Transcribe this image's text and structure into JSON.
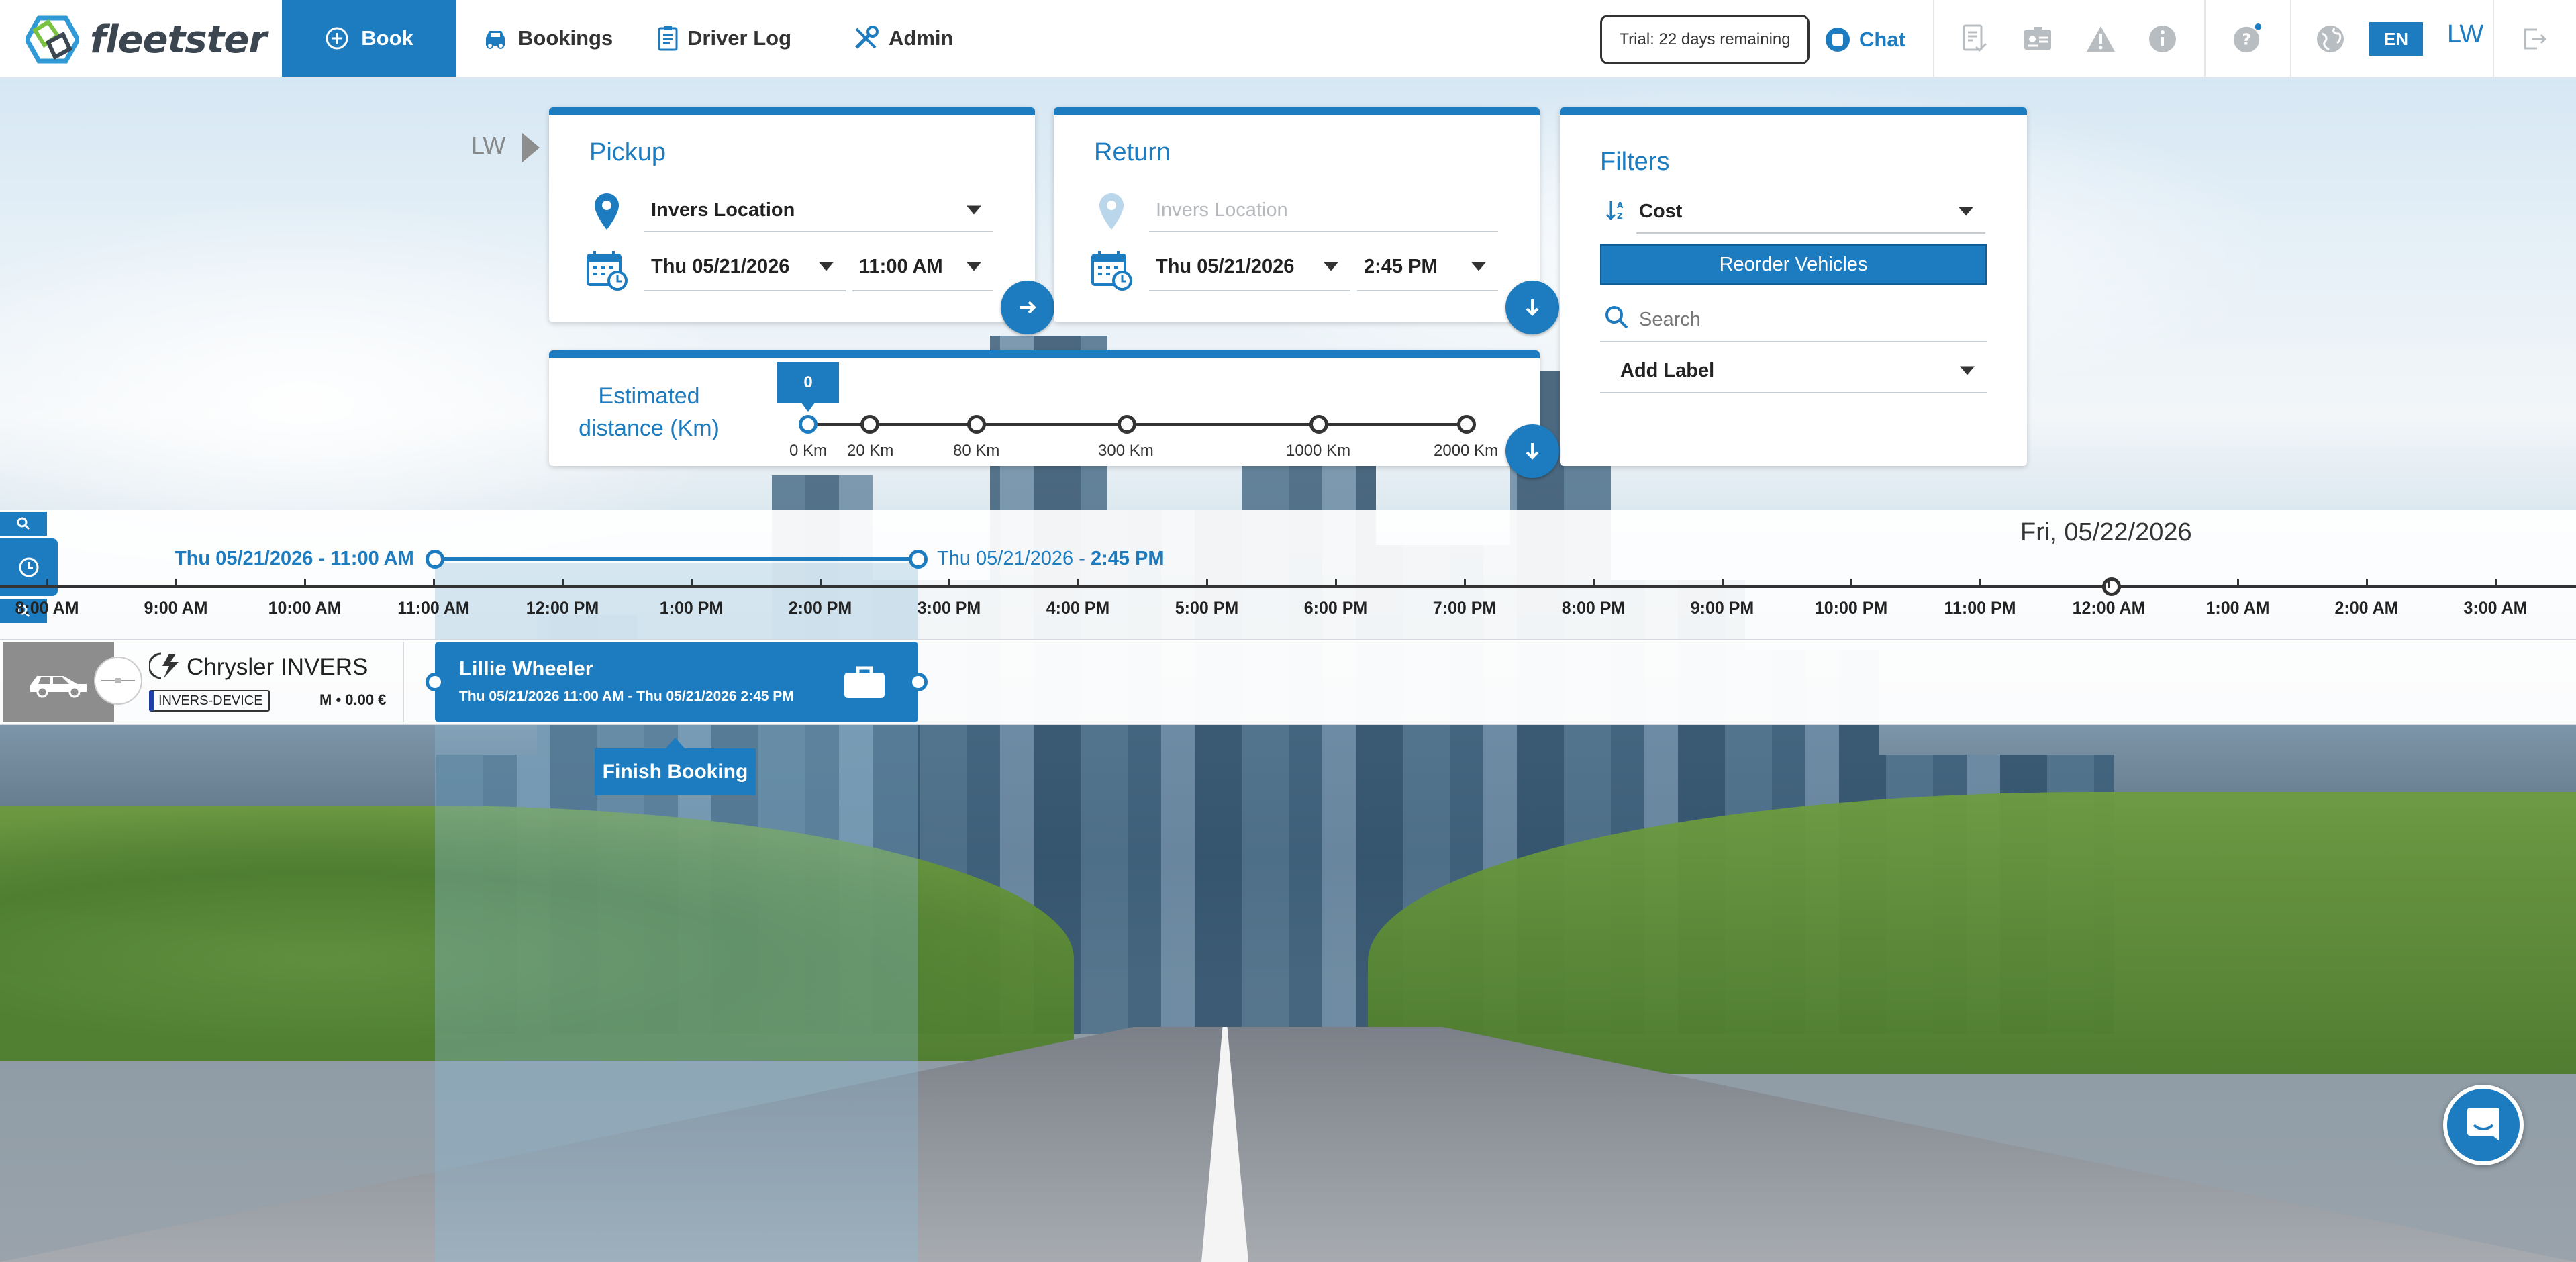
{
  "brand": {
    "name": "fleetster",
    "accent": "#1d7cbf"
  },
  "nav": {
    "book": "Book",
    "bookings": "Bookings",
    "driver_log": "Driver Log",
    "admin": "Admin"
  },
  "header": {
    "trial": "Trial: 22 days remaining",
    "chat": "Chat",
    "language": "EN",
    "user_initials": "LW",
    "icons": [
      "reports-icon",
      "id-card-icon",
      "warning-icon",
      "info-icon",
      "help-icon",
      "globe-icon",
      "logout-icon"
    ]
  },
  "driver_label": "LW",
  "pickup": {
    "title": "Pickup",
    "location": "Invers Location",
    "date": "Thu 05/21/2026",
    "time": "11:00 AM"
  },
  "return": {
    "title": "Return",
    "location_placeholder": "Invers Location",
    "date": "Thu 05/21/2026",
    "time": "2:45 PM"
  },
  "filters": {
    "title": "Filters",
    "sort": "Cost",
    "reorder_button": "Reorder Vehicles",
    "search_placeholder": "Search",
    "label_select": "Add Label"
  },
  "distance": {
    "title_line1": "Estimated",
    "title_line2": "distance (Km)",
    "selected": "0",
    "stops": [
      "0 Km",
      "20 Km",
      "80 Km",
      "300 Km",
      "1000 Km",
      "2000 Km"
    ]
  },
  "timeline": {
    "start_date": "Thu 05/21/2026 - ",
    "start_time": "11:00 AM",
    "end_date": "Thu 05/21/2026 - ",
    "end_time": "2:45 PM",
    "next_day": "Fri, 05/22/2026",
    "hours": [
      "8:00 AM",
      "9:00 AM",
      "10:00 AM",
      "11:00 AM",
      "12:00 PM",
      "1:00 PM",
      "2:00 PM",
      "3:00 PM",
      "4:00 PM",
      "5:00 PM",
      "6:00 PM",
      "7:00 PM",
      "8:00 PM",
      "9:00 PM",
      "10:00 PM",
      "11:00 PM",
      "12:00 AM",
      "1:00 AM",
      "2:00 AM",
      "3:00 AM"
    ]
  },
  "vehicle": {
    "name": "Chrysler INVERS",
    "device": "INVERS-DEVICE",
    "meta": "M • 0.00 €"
  },
  "booking": {
    "driver": "Lillie Wheeler",
    "range": "Thu 05/21/2026 11:00 AM - Thu 05/21/2026 2:45 PM",
    "finish": "Finish Booking"
  }
}
